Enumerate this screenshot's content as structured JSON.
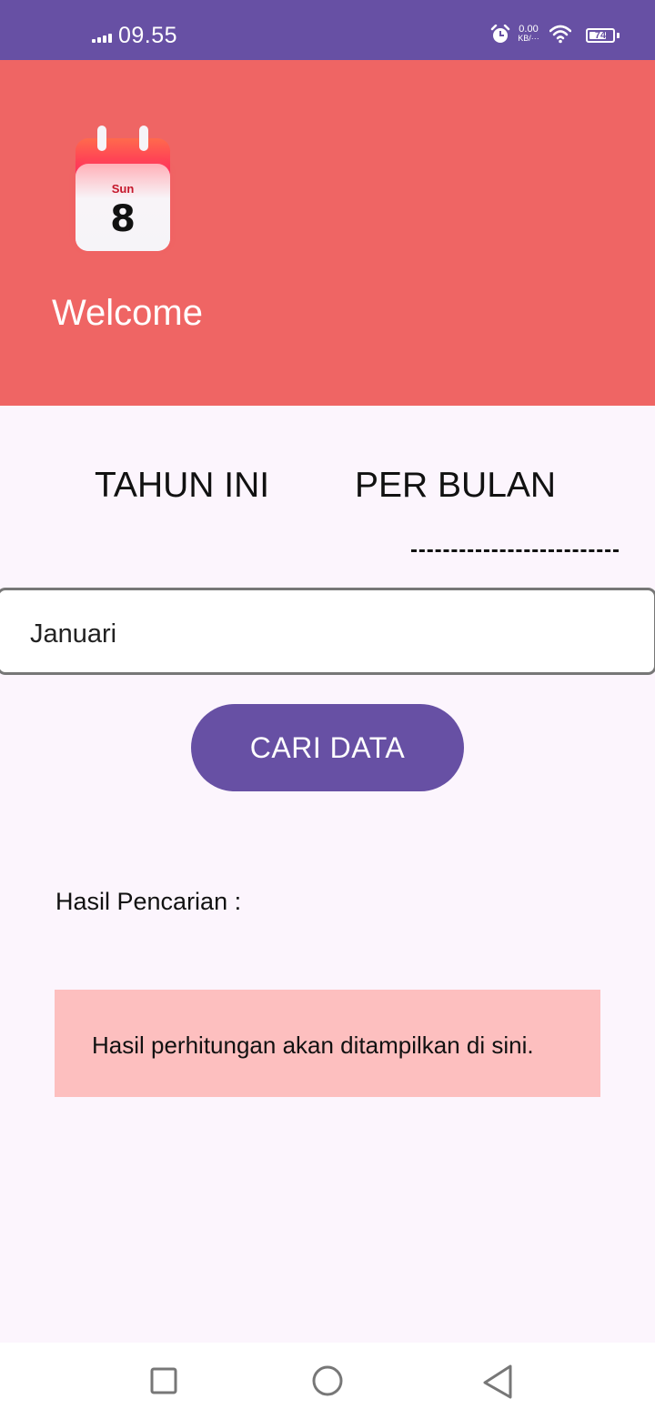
{
  "status_bar": {
    "time": "09.55",
    "net_speed_value": "0.00",
    "net_speed_unit": "KB/···",
    "battery_level": "74",
    "battery_fraction": 0.74,
    "icons": [
      "signal-icon",
      "alarm-icon",
      "wifi-icon",
      "battery-icon"
    ]
  },
  "header": {
    "calendar_day": "Sun",
    "calendar_date": "8",
    "welcome": "Welcome",
    "background_color": "#ef6564"
  },
  "tabs": [
    {
      "label": "TAHUN INI",
      "selected": false
    },
    {
      "label": "PER BULAN",
      "selected": true
    }
  ],
  "month_input": {
    "value": "Januari"
  },
  "search_button": {
    "label": "CARI DATA",
    "color": "#6750a4"
  },
  "result": {
    "label": "Hasil Pencarian :",
    "placeholder": "Hasil perhitungan akan ditampilkan di sini.",
    "box_color": "#fdbfbf"
  },
  "nav_bar": {
    "icons": [
      "recent-apps-icon",
      "home-icon",
      "back-icon"
    ]
  },
  "theme": {
    "primary": "#6750a4",
    "page_background": "#fcf5fd"
  }
}
